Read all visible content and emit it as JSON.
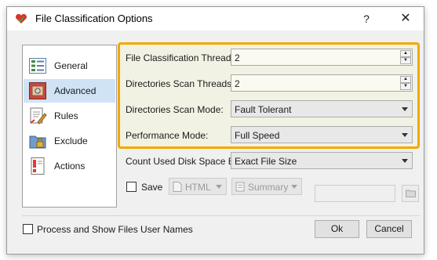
{
  "window": {
    "title": "File Classification Options",
    "help_label": "?",
    "close_label": "✕"
  },
  "sidebar": {
    "items": [
      {
        "label": "General",
        "icon": "general-icon"
      },
      {
        "label": "Advanced",
        "icon": "advanced-icon",
        "selected": true
      },
      {
        "label": "Rules",
        "icon": "rules-icon"
      },
      {
        "label": "Exclude",
        "icon": "exclude-icon"
      },
      {
        "label": "Actions",
        "icon": "actions-icon"
      }
    ]
  },
  "settings": {
    "classification_threads_label": "File Classification Threads:",
    "classification_threads_value": "2",
    "scan_threads_label": "Directories Scan Threads:",
    "scan_threads_value": "2",
    "scan_mode_label": "Directories Scan Mode:",
    "scan_mode_value": "Fault Tolerant",
    "performance_mode_label": "Performance Mode:",
    "performance_mode_value": "Full Speed",
    "disk_space_label": "Count Used Disk Space By:",
    "disk_space_value": "Exact File Size"
  },
  "save": {
    "label": "Save",
    "checked": false,
    "format_value": "HTML",
    "report_value": "Summary"
  },
  "footer": {
    "user_names_label": "Process and Show Files User Names",
    "user_names_checked": false,
    "ok_label": "Ok",
    "cancel_label": "Cancel"
  },
  "colors": {
    "highlight_border": "#f2a900",
    "selected_item": "#cfe3f5"
  }
}
